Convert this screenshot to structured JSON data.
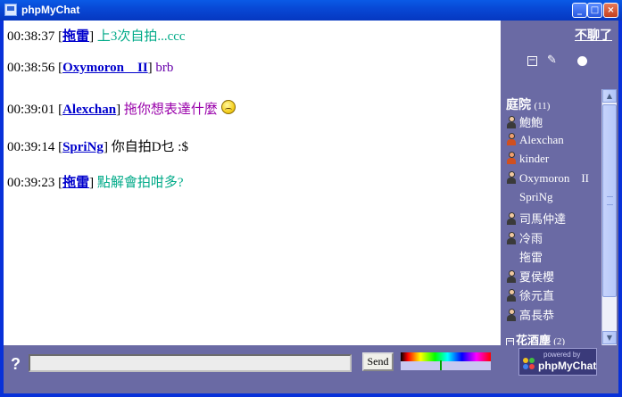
{
  "window": {
    "title": "phpMyChat"
  },
  "messages": [
    {
      "time": "00:38:37",
      "nick": "拖雷",
      "text": "上3次自拍...ccc",
      "color": "#00aa88"
    },
    {
      "time": "00:38:56",
      "nick": "Oxymoron    II",
      "text": "brb",
      "color": "#6600aa"
    },
    {
      "time": "00:39:01",
      "nick": "Alexchan",
      "text": "拖你想表達什麼",
      "color": "#9900aa",
      "smiley": true
    },
    {
      "time": "00:39:14",
      "nick": "SpriNg",
      "text": "你自拍D乜 :$",
      "color": "#000000"
    },
    {
      "time": "00:39:23",
      "nick": "拖雷",
      "text": "點解會拍咁多?",
      "color": "#00aa88"
    }
  ],
  "sidebar": {
    "leave_label": "不聊了",
    "room1": {
      "name": "庭院",
      "count": "(11)"
    },
    "users": [
      {
        "name": "鮑鮑",
        "icon": "male"
      },
      {
        "name": "Alexchan",
        "icon": "female"
      },
      {
        "name": "kinder",
        "icon": "female"
      },
      {
        "name": "Oxymoron    II",
        "icon": "male"
      },
      {
        "name": "SpriNg",
        "icon": "none"
      },
      {
        "name": "司馬仲達",
        "icon": "male"
      },
      {
        "name": "冷雨",
        "icon": "male"
      },
      {
        "name": "拖雷",
        "icon": "none"
      },
      {
        "name": "夏侯櫻",
        "icon": "male"
      },
      {
        "name": "徐元直",
        "icon": "male"
      },
      {
        "name": "高長恭",
        "icon": "male"
      }
    ],
    "room2": {
      "name": "花酒塵",
      "count": "(2)"
    }
  },
  "input": {
    "value": "",
    "placeholder": ""
  },
  "send_label": "Send",
  "help_label": "?",
  "logo": {
    "top": "powered by",
    "bottom": "phpMyChat"
  },
  "colors": {
    "sidebar_bg": "#6a6aa4",
    "titlebar": "#0849d6",
    "nick": "#0000cc"
  }
}
